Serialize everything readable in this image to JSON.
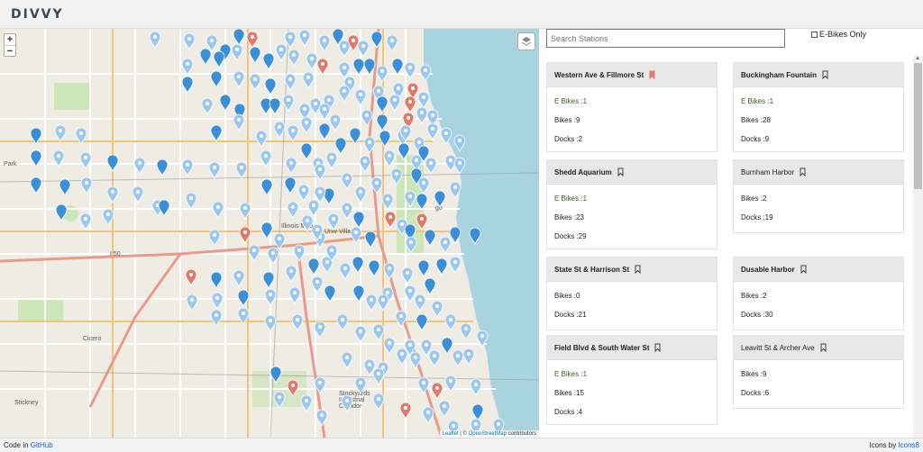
{
  "header": {
    "logo_text": "DIVVY"
  },
  "map": {
    "zoom_in": "+",
    "zoom_out": "−",
    "attribution": {
      "leaflet": "Leaflet",
      "sep": " | © ",
      "osm": "OpenStreetMap",
      "suffix": " contributors"
    },
    "labels": {
      "park": "Park",
      "cicero": "Cicero",
      "stickney": "Stickney",
      "i50": "I 50",
      "illinois": "Illinois Med",
      "univ": "Univ Villa",
      "stockyards": "Stockyards Industrial Corridor",
      "go": "go",
      "p": "P"
    },
    "colors": {
      "pin_full": "#3b8fd6",
      "pin_light": "#9cc8ef",
      "pin_red": "#e07a6b",
      "water": "#a9d3df"
    }
  },
  "search": {
    "placeholder": "Search Stations"
  },
  "filter": {
    "ebike_label": "E-Bikes Only"
  },
  "stations": [
    {
      "name": "Western Ave & Fillmore St",
      "bookmarked": true,
      "rows": [
        {
          "label": "E Bikes :1",
          "eb": true
        },
        {
          "label": "Bikes :9"
        },
        {
          "label": "Docks :2"
        }
      ]
    },
    {
      "name": "Buckingham Fountain",
      "bookmarked": false,
      "rows": [
        {
          "label": "E Bikes :1",
          "eb": true
        },
        {
          "label": "Bikes :28"
        },
        {
          "label": "Docks :9"
        }
      ]
    },
    {
      "name": "Shedd Aquarium",
      "bookmarked": false,
      "rows": [
        {
          "label": "E Bikes :1",
          "eb": true
        },
        {
          "label": "Bikes :23"
        },
        {
          "label": "Docks :29"
        }
      ]
    },
    {
      "name": "Burnham Harbor",
      "bookmarked": false,
      "rows": [
        {
          "label": "Bikes :2"
        },
        {
          "label": "Docks :19"
        }
      ]
    },
    {
      "name": "State St & Harrison St",
      "bookmarked": false,
      "rows": [
        {
          "label": "Bikes :0"
        },
        {
          "label": "Docks :21"
        }
      ]
    },
    {
      "name": "Dusable Harbor",
      "bookmarked": false,
      "rows": [
        {
          "label": "Bikes :2"
        },
        {
          "label": "Docks :30"
        }
      ]
    },
    {
      "name": "Field Blvd & South Water St",
      "bookmarked": false,
      "rows": [
        {
          "label": "E Bikes :1",
          "eb": true
        },
        {
          "label": "Bikes :15"
        },
        {
          "label": "Docks :4"
        }
      ]
    },
    {
      "name": "Leavitt St & Archer Ave",
      "bookmarked": false,
      "rows": [
        {
          "label": "Bikes :9"
        },
        {
          "label": "Docks :6"
        }
      ]
    }
  ],
  "footer": {
    "code_prefix": "Code in ",
    "code_link": "GitHub",
    "icons_prefix": "Icons by ",
    "icons_link": "Icons8"
  }
}
